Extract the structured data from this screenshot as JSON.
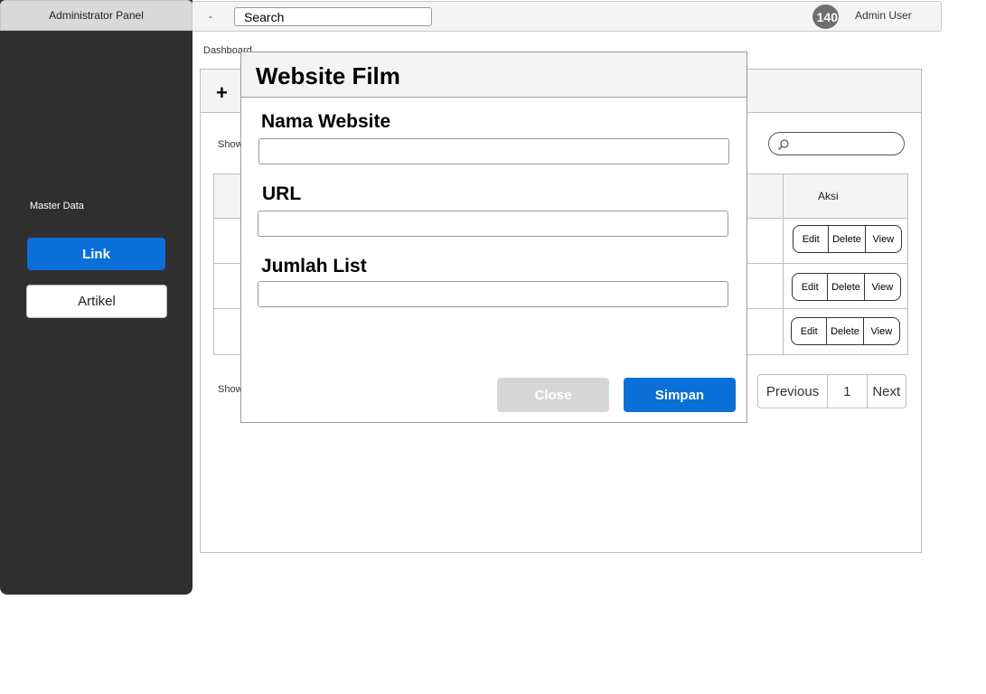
{
  "sidebar": {
    "title": "Administrator Panel",
    "section_label": "Master Data",
    "items": [
      {
        "label": "Link",
        "active": true
      },
      {
        "label": "Artikel",
        "active": false
      }
    ]
  },
  "topbar": {
    "menu_toggle": "-",
    "search_value": "Search",
    "avatar_text": "140",
    "user_name": "Admin User"
  },
  "breadcrumb": "Dashboard",
  "card": {
    "add_label": "+",
    "show_top": "Show",
    "show_bottom": "Show",
    "table": {
      "action_header": "Aksi",
      "rows": [
        {
          "actions": [
            "Edit",
            "Delete",
            "View"
          ]
        },
        {
          "actions": [
            "Edit",
            "Delete",
            "View"
          ]
        },
        {
          "actions": [
            "Edit",
            "Delete",
            "View"
          ]
        }
      ]
    },
    "pagination": {
      "previous": "Previous",
      "page": "1",
      "next": "Next"
    }
  },
  "modal": {
    "title": "Website Film",
    "fields": [
      {
        "label": "Nama Website",
        "value": ""
      },
      {
        "label": "URL",
        "value": ""
      },
      {
        "label": "Jumlah List",
        "value": ""
      }
    ],
    "close_label": "Close",
    "save_label": "Simpan"
  },
  "colors": {
    "sidebar_bg": "#2f2f2f",
    "primary": "#0a6fd6",
    "disabled": "#d6d6d6"
  }
}
